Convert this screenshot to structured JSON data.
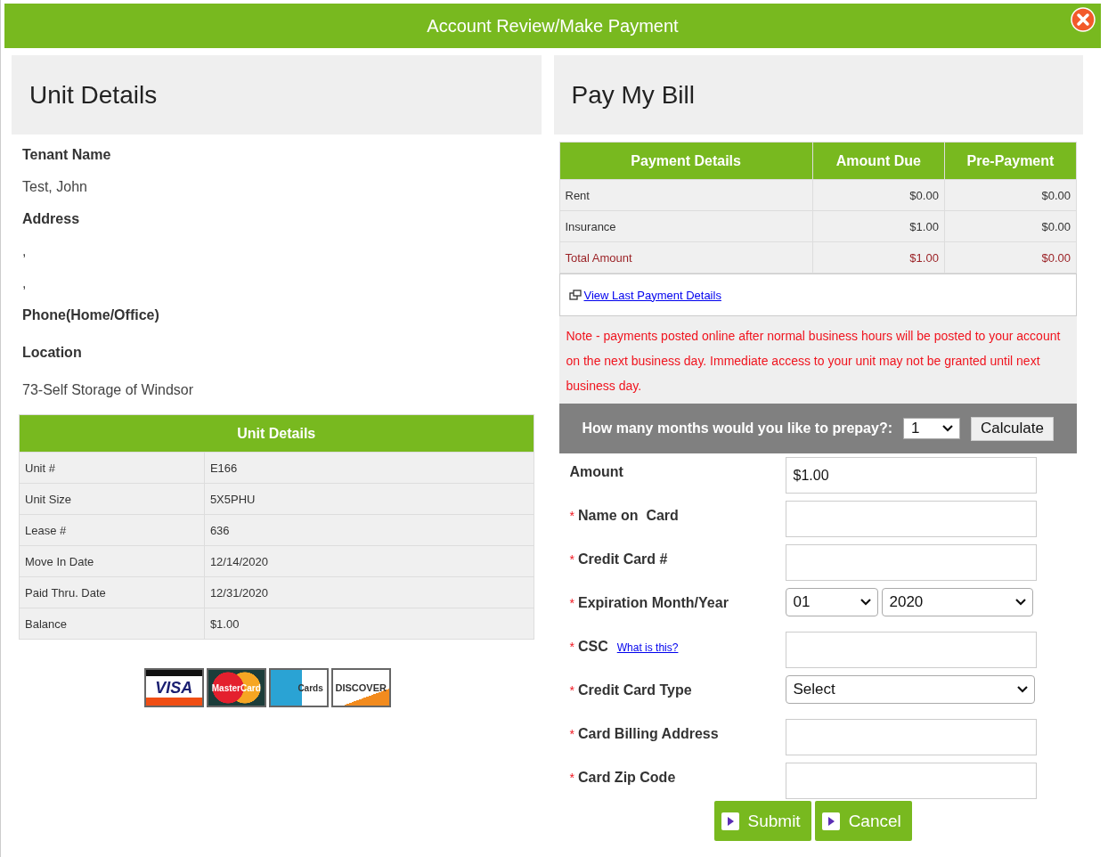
{
  "window": {
    "title": "Account Review/Make Payment"
  },
  "unit_panel": {
    "heading": "Unit Details",
    "info": [
      {
        "kind": "label",
        "text": "Tenant Name"
      },
      {
        "kind": "value",
        "text": "Test, John"
      },
      {
        "kind": "label",
        "text": "Address"
      },
      {
        "kind": "value",
        "text": ","
      },
      {
        "kind": "value",
        "text": ","
      },
      {
        "kind": "label",
        "text": "Phone(Home/Office)"
      },
      {
        "kind": "label",
        "text": "Location"
      },
      {
        "kind": "value",
        "text": "73-Self Storage of Windsor"
      }
    ],
    "table": {
      "title": "Unit Details",
      "rows": [
        [
          "Unit #",
          "E166"
        ],
        [
          "Unit Size",
          "5X5PHU"
        ],
        [
          "Lease #",
          "636"
        ],
        [
          "Move In Date",
          "12/14/2020"
        ],
        [
          "Paid Thru. Date",
          "12/31/2020"
        ],
        [
          "Balance",
          "$1.00"
        ]
      ]
    },
    "card_logos": [
      {
        "kind": "visa",
        "text": "VISA"
      },
      {
        "kind": "mastercard",
        "text": "MasterCard"
      },
      {
        "kind": "amex",
        "text": "Cards"
      },
      {
        "kind": "discover",
        "text": "DISCOVER"
      }
    ]
  },
  "bill_panel": {
    "heading": "Pay My Bill",
    "payment_table": {
      "columns": [
        "Payment Details",
        "Amount Due",
        "Pre-Payment"
      ],
      "rows": [
        {
          "kind": "item",
          "cells": [
            "Rent",
            "$0.00",
            "$0.00"
          ]
        },
        {
          "kind": "item",
          "cells": [
            "Insurance",
            "$1.00",
            "$0.00"
          ]
        },
        {
          "kind": "total",
          "cells": [
            "Total Amount",
            "$1.00",
            "$0.00"
          ]
        }
      ]
    },
    "link": "View Last Payment Details",
    "note": "Note - payments posted online after normal business hours will be posted to your account on the next business day. Immediate access to your unit may not be granted until next business day.",
    "prepay": {
      "question": "How many months would you like to prepay?:",
      "months": "1",
      "button": "Calculate"
    },
    "form": [
      {
        "kind": "text",
        "label": "Amount",
        "value": "$1.00"
      },
      {
        "kind": "text",
        "marker": "*",
        "label": "Name on  Card"
      },
      {
        "kind": "text",
        "marker": "*",
        "label": "Credit Card #"
      },
      {
        "kind": "expiry",
        "marker": "*",
        "label": "Expiration Month/Year",
        "values": [
          "01",
          "2020"
        ]
      },
      {
        "kind": "csc",
        "marker": "*",
        "label": "CSC",
        "link": "What is this?"
      },
      {
        "kind": "select",
        "marker": "*",
        "label": "Credit Card Type",
        "value": "Select"
      },
      {
        "kind": "text",
        "marker": "*",
        "label": "Card Billing Address"
      },
      {
        "kind": "text",
        "marker": "*",
        "label": "Card Zip Code"
      }
    ],
    "buttons": [
      "Submit",
      "Cancel"
    ]
  }
}
